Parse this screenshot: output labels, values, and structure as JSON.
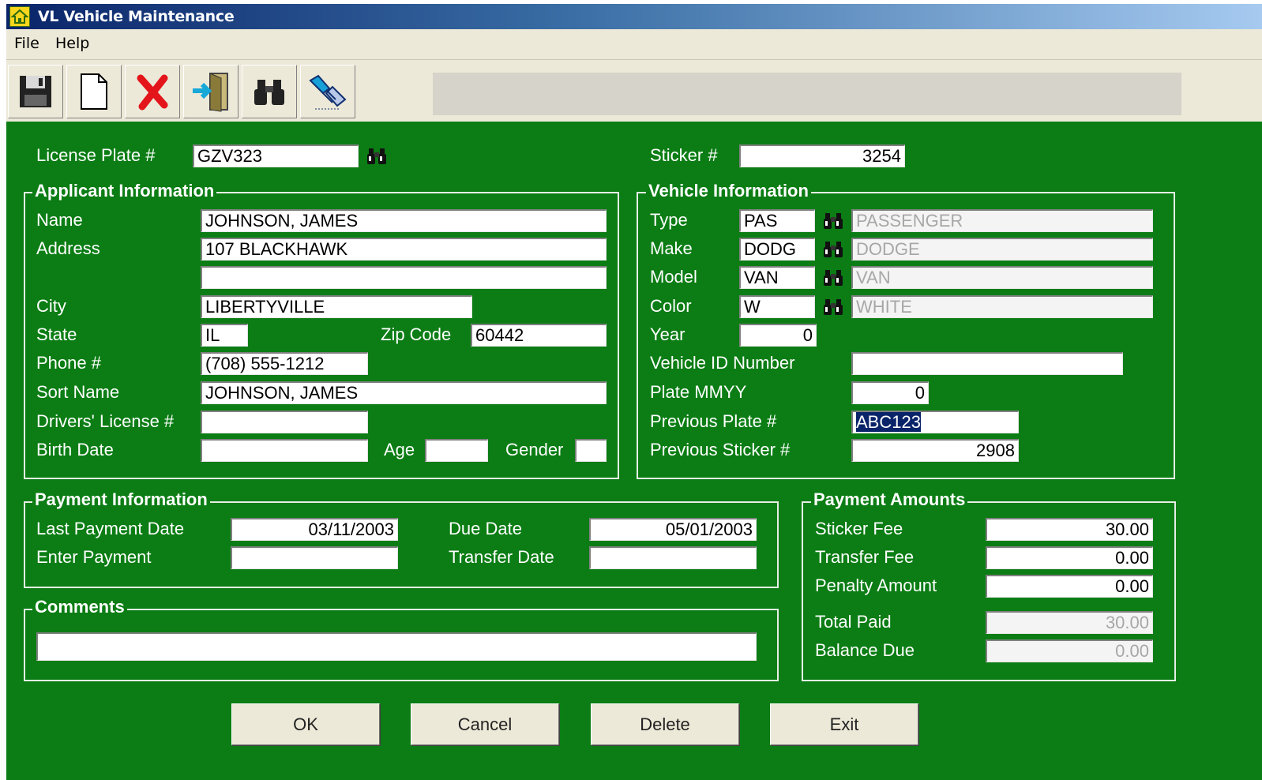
{
  "window": {
    "title": "VL Vehicle Maintenance"
  },
  "menu": [
    "File",
    "Help"
  ],
  "toolbar": {
    "icons": [
      "save-icon",
      "new-document-icon",
      "delete-icon",
      "exit-door-icon",
      "binoculars-icon",
      "handshake-icon"
    ]
  },
  "header": {
    "license_plate_label": "License Plate #",
    "license_plate_value": "GZV323",
    "sticker_label": "Sticker #",
    "sticker_value": "3254"
  },
  "applicant": {
    "legend": "Applicant Information",
    "name_label": "Name",
    "name_value": "JOHNSON, JAMES",
    "address_label": "Address",
    "address_line1": "107 BLACKHAWK",
    "address_line2": "",
    "city_label": "City",
    "city_value": "LIBERTYVILLE",
    "state_label": "State",
    "state_value": "IL",
    "zip_label": "Zip Code",
    "zip_value": "60442",
    "phone_label": "Phone #",
    "phone_value": "(708) 555-1212",
    "sort_name_label": "Sort Name",
    "sort_name_value": "JOHNSON, JAMES",
    "drivers_license_label": "Drivers' License #",
    "drivers_license_value": "",
    "birth_date_label": "Birth Date",
    "birth_date_value": "",
    "age_label": "Age",
    "age_value": "",
    "gender_label": "Gender",
    "gender_value": ""
  },
  "vehicle": {
    "legend": "Vehicle Information",
    "type_label": "Type",
    "type_code": "PAS",
    "type_desc": "PASSENGER",
    "make_label": "Make",
    "make_code": "DODG",
    "make_desc": "DODGE",
    "model_label": "Model",
    "model_code": "VAN",
    "model_desc": "VAN",
    "color_label": "Color",
    "color_code": "W",
    "color_desc": "WHITE",
    "year_label": "Year",
    "year_value": "0",
    "vin_label": "Vehicle ID Number",
    "vin_value": "",
    "plate_mmyy_label": "Plate MMYY",
    "plate_mmyy_value": "0",
    "prev_plate_label": "Previous Plate #",
    "prev_plate_value": "ABC123",
    "prev_sticker_label": "Previous Sticker #",
    "prev_sticker_value": "2908"
  },
  "payment": {
    "legend": "Payment Information",
    "last_payment_label": "Last Payment Date",
    "last_payment_value": "03/11/2003",
    "due_date_label": "Due Date",
    "due_date_value": "05/01/2003",
    "enter_payment_label": "Enter Payment",
    "enter_payment_value": "",
    "transfer_date_label": "Transfer Date",
    "transfer_date_value": ""
  },
  "amounts": {
    "legend": "Payment Amounts",
    "sticker_fee_label": "Sticker Fee",
    "sticker_fee_value": "30.00",
    "transfer_fee_label": "Transfer Fee",
    "transfer_fee_value": "0.00",
    "penalty_label": "Penalty Amount",
    "penalty_value": "0.00",
    "total_paid_label": "Total Paid",
    "total_paid_value": "30.00",
    "balance_due_label": "Balance Due",
    "balance_due_value": "0.00"
  },
  "comments": {
    "legend": "Comments",
    "value": ""
  },
  "buttons": {
    "ok": "OK",
    "cancel": "Cancel",
    "delete": "Delete",
    "exit": "Exit"
  },
  "colors": {
    "form_background": "#0b7d14",
    "title_bar": "#0a246a",
    "chrome": "#ece9d8"
  }
}
